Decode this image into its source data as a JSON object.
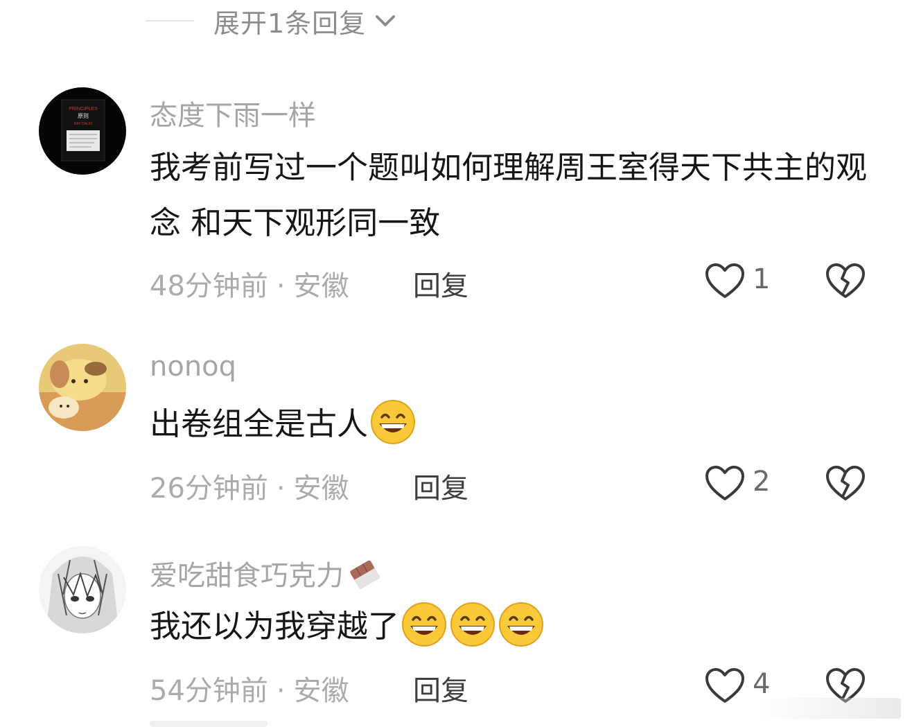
{
  "expand_replies": {
    "label": "展开1条回复"
  },
  "comments": [
    {
      "username": "态度下雨一样",
      "text": "我考前写过一个题叫如何理解周王室得天下共主的观念 和天下观形同一致",
      "time": "48分钟前",
      "location": "安徽",
      "reply_label": "回复",
      "like_count": "1",
      "avatar": {
        "book_title": "PRINCIPLES",
        "book_subtitle": "原则",
        "book_author": "RAY DALIO"
      }
    },
    {
      "username": "nonoq",
      "text": "出卷组全是古人",
      "emojis": [
        "grinning-face-emoji"
      ],
      "time": "26分钟前",
      "location": "安徽",
      "reply_label": "回复",
      "like_count": "2"
    },
    {
      "username": "爱吃甜食巧克力",
      "username_emoji": "chocolate-bar-emoji",
      "text": "我还以为我穿越了",
      "emojis": [
        "grinning-face-emoji",
        "grinning-face-emoji",
        "grinning-face-emoji"
      ],
      "time": "54分钟前",
      "location": "安徽",
      "reply_label": "回复",
      "like_count": "4"
    }
  ],
  "meta_separator": "·",
  "colors": {
    "username": "#a5a5a5",
    "body": "#161616",
    "meta": "#ababab",
    "reply": "#3e3e3e",
    "icon_stroke": "#3a3a3a"
  }
}
